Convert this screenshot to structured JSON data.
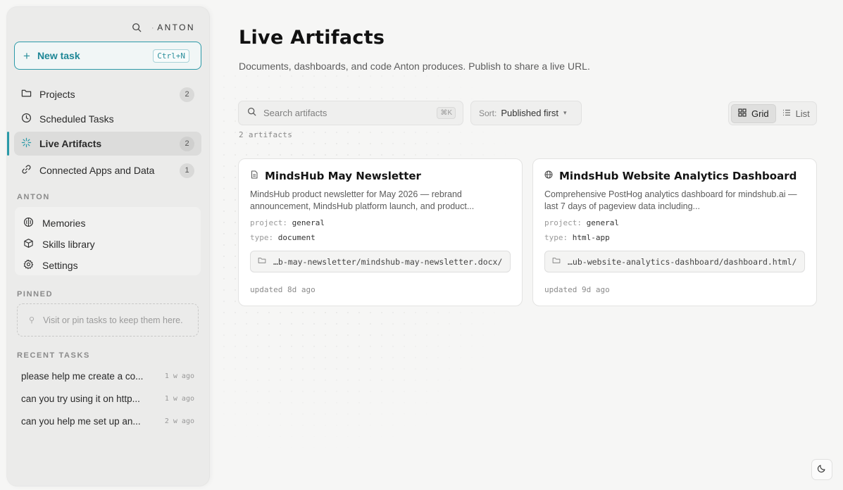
{
  "sidebar": {
    "brand": "ANTON",
    "new_task": {
      "label": "New task",
      "shortcut": "Ctrl+N"
    },
    "nav": [
      {
        "label": "Projects",
        "count": "2",
        "icon": "folder-icon"
      },
      {
        "label": "Scheduled Tasks",
        "count": "",
        "icon": "clock-icon"
      },
      {
        "label": "Live Artifacts",
        "count": "2",
        "icon": "sparkle-icon",
        "active": true
      },
      {
        "label": "Connected Apps and Data",
        "count": "1",
        "icon": "link-icon"
      }
    ],
    "anton_section": {
      "heading": "ANTON",
      "items": [
        {
          "label": "Memories",
          "icon": "brain-icon"
        },
        {
          "label": "Skills library",
          "icon": "cube-icon"
        },
        {
          "label": "Settings",
          "icon": "gear-icon"
        }
      ]
    },
    "pinned": {
      "heading": "PINNED",
      "empty_text": "Visit or pin tasks to keep them here."
    },
    "recent": {
      "heading": "RECENT TASKS",
      "items": [
        {
          "title": "please help me create a co...",
          "ago": "1 w ago"
        },
        {
          "title": "can you try using it on http...",
          "ago": "1 w ago"
        },
        {
          "title": "can you help me set up an...",
          "ago": "2 w ago"
        }
      ]
    }
  },
  "main": {
    "title": "Live Artifacts",
    "subtitle": "Documents, dashboards, and code Anton produces. Publish to share a live URL.",
    "search": {
      "placeholder": "Search artifacts",
      "shortcut": "⌘K"
    },
    "sort": {
      "label": "Sort:",
      "value": "Published first"
    },
    "view": {
      "grid": "Grid",
      "list": "List",
      "selected": "grid"
    },
    "count_text": "2 artifacts",
    "artifacts": [
      {
        "icon": "document-icon",
        "title": "MindsHub May Newsletter",
        "description": "MindsHub product newsletter for May 2026 — rebrand announcement, MindsHub platform launch, and product...",
        "project_label": "project:",
        "project": "general",
        "type_label": "type:",
        "type": "document",
        "path": "…b-may-newsletter/mindshub-may-newsletter.docx/",
        "updated": "updated 8d ago"
      },
      {
        "icon": "globe-icon",
        "title": "MindsHub Website Analytics Dashboard",
        "description": "Comprehensive PostHog analytics dashboard for mindshub.ai — last 7 days of pageview data including...",
        "project_label": "project:",
        "project": "general",
        "type_label": "type:",
        "type": "html-app",
        "path": "…ub-website-analytics-dashboard/dashboard.html/",
        "updated": "updated 9d ago"
      }
    ]
  },
  "colors": {
    "accent": "#2c9aa8",
    "sidebar_bg": "#ebebea",
    "page_bg": "#f6f6f5"
  }
}
